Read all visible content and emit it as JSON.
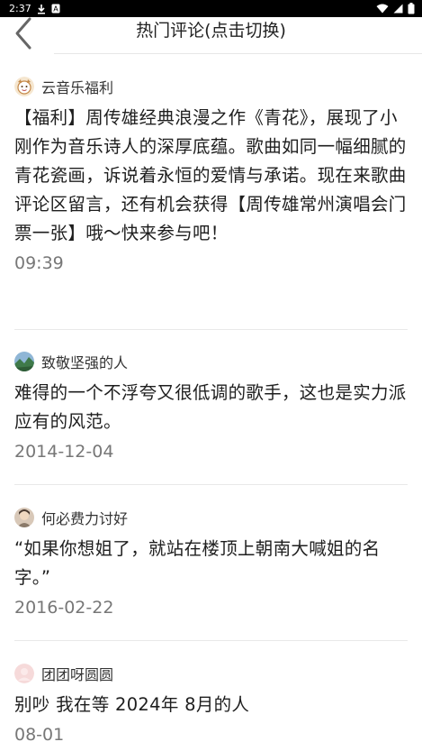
{
  "status_bar": {
    "time": "2:37"
  },
  "header": {
    "title": "热门评论(点击切换)"
  },
  "comments": [
    {
      "username": "云音乐福利",
      "text": "【福利】周传雄经典浪漫之作《青花》，展现了小刚作为音乐诗人的深厚底蕴。歌曲如同一幅细腻的青花瓷画，诉说着永恒的爱情与承诺。现在来歌曲评论区留言，还有机会获得【周传雄常州演唱会门票一张】哦～快来参与吧！",
      "time": "09:39"
    },
    {
      "username": "致敬坚强的人",
      "text": "难得的一个不浮夸又很低调的歌手，这也是实力派应有的风范。",
      "time": "2014-12-04"
    },
    {
      "username": "何必费力讨好",
      "text": "“如果你想姐了，就站在楼顶上朝南大喊姐的名字。”",
      "time": "2016-02-22"
    },
    {
      "username": "团团呀圆圆",
      "text": "别吵 我在等 2024年 8月的人",
      "time": "08-01"
    }
  ]
}
